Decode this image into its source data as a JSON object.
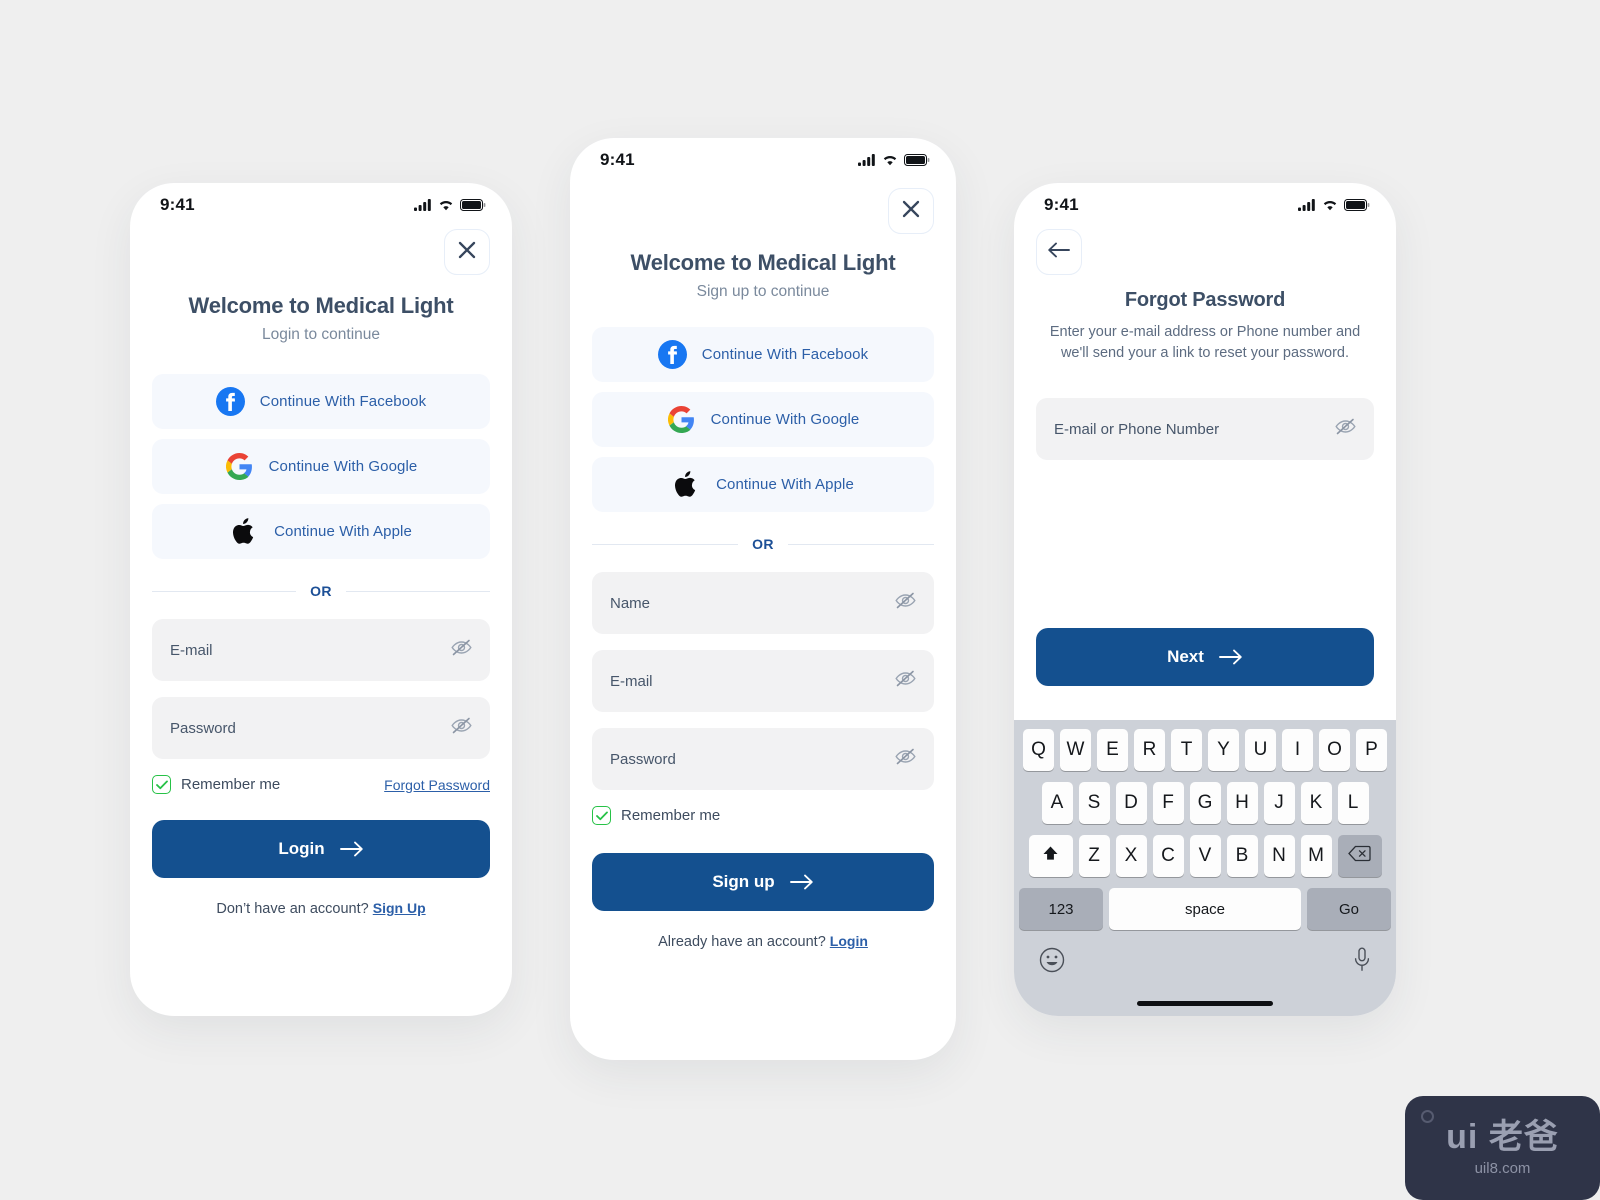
{
  "app": {
    "brand": "Medical Light",
    "accent": "#14508f",
    "surface": "#f5f8fd",
    "field_bg": "#f2f2f3",
    "check_green": "#27c247"
  },
  "status_bar": {
    "time": "9:41",
    "signal_icon": "cellular-signal-icon",
    "wifi_icon": "wifi-icon",
    "battery_icon": "battery-icon"
  },
  "login_screen": {
    "close_label": "✕",
    "title": "Welcome to Medical Light",
    "subtitle": "Login to continue",
    "social": [
      {
        "label": "Continue With Facebook",
        "icon": "facebook-icon"
      },
      {
        "label": "Continue With Google",
        "icon": "google-icon"
      },
      {
        "label": "Continue With Apple",
        "icon": "apple-icon"
      }
    ],
    "divider": "OR",
    "fields": [
      {
        "placeholder": "E-mail",
        "value": "",
        "trailing_icon": "eye-off-icon"
      },
      {
        "placeholder": "Password",
        "value": "",
        "trailing_icon": "eye-off-icon"
      }
    ],
    "remember_label": "Remember me",
    "remember_checked": true,
    "forgot_link": "Forgot Password",
    "submit_label": "Login",
    "footer_text": "Don’t have an account?",
    "footer_link": "Sign Up"
  },
  "signup_screen": {
    "close_label": "✕",
    "title": "Welcome to Medical Light",
    "subtitle": "Sign up to continue",
    "social": [
      {
        "label": "Continue With Facebook",
        "icon": "facebook-icon"
      },
      {
        "label": "Continue With Google",
        "icon": "google-icon"
      },
      {
        "label": "Continue With Apple",
        "icon": "apple-icon"
      }
    ],
    "divider": "OR",
    "fields": [
      {
        "placeholder": "Name",
        "value": "",
        "trailing_icon": "eye-off-icon"
      },
      {
        "placeholder": "E-mail",
        "value": "",
        "trailing_icon": "eye-off-icon"
      },
      {
        "placeholder": "Password",
        "value": "",
        "trailing_icon": "eye-off-icon"
      }
    ],
    "remember_label": "Remember me",
    "remember_checked": true,
    "submit_label": "Sign up",
    "footer_text": "Already have an account?",
    "footer_link": "Login"
  },
  "forgot_screen": {
    "back_label": "←",
    "title": "Forgot Password",
    "description": "Enter your e-mail address or Phone number and we'll send your a link to reset your password.",
    "field": {
      "placeholder": "E-mail or Phone Number",
      "value": "",
      "trailing_icon": "eye-off-icon"
    },
    "submit_label": "Next",
    "keyboard": {
      "row1": [
        "Q",
        "W",
        "E",
        "R",
        "T",
        "Y",
        "U",
        "I",
        "O",
        "P"
      ],
      "row2": [
        "A",
        "S",
        "D",
        "F",
        "G",
        "H",
        "J",
        "K",
        "L"
      ],
      "row3": [
        "Z",
        "X",
        "C",
        "V",
        "B",
        "N",
        "M"
      ],
      "shift_label": "shift-icon",
      "backspace_label": "backspace-icon",
      "numbers_label": "123",
      "space_label": "space",
      "return_label": "Go",
      "emoji_label": "emoji-icon",
      "mic_label": "microphone-icon"
    }
  },
  "watermark": {
    "main": "ui 老爸",
    "sub": "uil8.com"
  }
}
